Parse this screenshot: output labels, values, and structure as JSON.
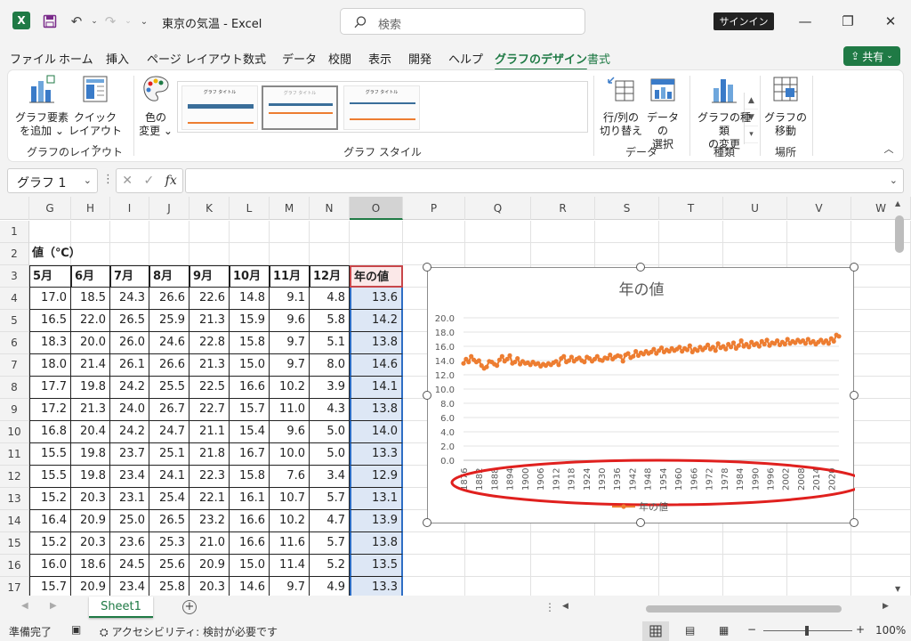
{
  "window": {
    "title": "東京の気温  -  Excel",
    "search_placeholder": "検索",
    "signin_label": "サインイン",
    "minimize": "—",
    "restore": "❐",
    "close": "✕"
  },
  "tabs": [
    "ファイル",
    "ホーム",
    "挿入",
    "ページ レイアウト",
    "数式",
    "データ",
    "校閲",
    "表示",
    "開発",
    "ヘルプ",
    "グラフのデザイン",
    "書式"
  ],
  "active_tab": "グラフのデザイン",
  "share_label": "共有",
  "ribbon": {
    "add_element": [
      "グラフ要素",
      "を追加 ⌄"
    ],
    "quick_layout": [
      "クイック",
      "レイアウト ⌄"
    ],
    "group_layout": "グラフのレイアウト",
    "change_colors": [
      "色の",
      "変更 ⌄"
    ],
    "group_styles": "グラフ スタイル",
    "switch_rowcol": [
      "行/列の",
      "切り替え"
    ],
    "select_data": [
      "データの",
      "選択"
    ],
    "group_data": "データ",
    "change_type": [
      "グラフの種類",
      "の変更"
    ],
    "group_type": "種類",
    "move_chart": [
      "グラフの",
      "移動"
    ],
    "group_location": "場所",
    "thumb_title": "グラフ タイトル",
    "collapse": "︿"
  },
  "formula_bar": {
    "name_box": "グラフ 1",
    "fx": "fx",
    "content": ""
  },
  "columns": [
    "G",
    "H",
    "I",
    "J",
    "K",
    "L",
    "M",
    "N",
    "O",
    "P",
    "Q",
    "R",
    "S",
    "T",
    "U",
    "V",
    "W"
  ],
  "rows": [
    "1",
    "2",
    "3",
    "4",
    "5",
    "6",
    "7",
    "8",
    "9",
    "10",
    "11",
    "12",
    "13",
    "14",
    "15",
    "16",
    "17"
  ],
  "sheet": {
    "label_cell": "値（℃）",
    "headers": [
      "5月",
      "6月",
      "7月",
      "8月",
      "9月",
      "10月",
      "11月",
      "12月",
      "年の値"
    ],
    "data": [
      [
        "17.0",
        "18.5",
        "24.3",
        "26.6",
        "22.6",
        "14.8",
        "9.1",
        "4.8",
        "13.6"
      ],
      [
        "16.5",
        "22.0",
        "26.5",
        "25.9",
        "21.3",
        "15.9",
        "9.6",
        "5.8",
        "14.2"
      ],
      [
        "18.3",
        "20.0",
        "26.0",
        "24.6",
        "22.8",
        "15.8",
        "9.7",
        "5.1",
        "13.8"
      ],
      [
        "18.0",
        "21.4",
        "26.1",
        "26.6",
        "21.3",
        "15.0",
        "9.7",
        "8.0",
        "14.6"
      ],
      [
        "17.7",
        "19.8",
        "24.2",
        "25.5",
        "22.5",
        "16.6",
        "10.2",
        "3.9",
        "14.1"
      ],
      [
        "17.2",
        "21.3",
        "24.0",
        "26.7",
        "22.7",
        "15.7",
        "11.0",
        "4.3",
        "13.8"
      ],
      [
        "16.8",
        "20.4",
        "24.2",
        "24.7",
        "21.1",
        "15.4",
        "9.6",
        "5.0",
        "14.0"
      ],
      [
        "15.5",
        "19.8",
        "23.7",
        "25.1",
        "21.8",
        "16.7",
        "10.0",
        "5.0",
        "13.3"
      ],
      [
        "15.5",
        "19.8",
        "23.4",
        "24.1",
        "22.3",
        "15.8",
        "7.6",
        "3.4",
        "12.9"
      ],
      [
        "15.2",
        "20.3",
        "23.1",
        "25.4",
        "22.1",
        "16.1",
        "10.7",
        "5.7",
        "13.1"
      ],
      [
        "16.4",
        "20.9",
        "25.0",
        "26.5",
        "23.2",
        "16.6",
        "10.2",
        "4.7",
        "13.9"
      ],
      [
        "15.2",
        "20.3",
        "23.6",
        "25.3",
        "21.0",
        "16.6",
        "11.6",
        "5.7",
        "13.8"
      ],
      [
        "16.0",
        "18.6",
        "24.5",
        "25.6",
        "20.9",
        "15.0",
        "11.4",
        "5.2",
        "13.5"
      ],
      [
        "15.7",
        "20.9",
        "23.4",
        "25.8",
        "20.3",
        "14.6",
        "9.7",
        "4.9",
        "13.3"
      ]
    ]
  },
  "chart_data": {
    "type": "line",
    "title": "年の値",
    "legend": "年の値",
    "legend_position": "bottom",
    "ylim": [
      0,
      20
    ],
    "yticks": [
      "20.0",
      "18.0",
      "16.0",
      "14.0",
      "12.0",
      "10.0",
      "8.0",
      "6.0",
      "4.0",
      "2.0",
      "0.0"
    ],
    "x_tick_labels": [
      "1876",
      "1882",
      "1888",
      "1894",
      "1900",
      "1906",
      "1912",
      "1918",
      "1924",
      "1930",
      "1936",
      "1942",
      "1948",
      "1954",
      "1960",
      "1966",
      "1972",
      "1978",
      "1984",
      "1990",
      "1996",
      "2002",
      "2008",
      "2014",
      "2020"
    ],
    "x_range": [
      1876,
      2023
    ],
    "series": [
      {
        "name": "年の値",
        "color": "#ed7d31",
        "values": [
          13.6,
          14.2,
          13.8,
          14.6,
          14.1,
          13.8,
          14.0,
          13.3,
          12.9,
          13.1,
          13.9,
          13.8,
          13.5,
          13.3,
          14.1,
          14.6,
          13.9,
          14.2,
          14.7,
          13.6,
          13.8,
          14.3,
          13.5,
          13.9,
          13.6,
          13.7,
          13.4,
          13.8,
          13.5,
          13.6,
          13.2,
          13.5,
          13.3,
          13.6,
          13.4,
          13.7,
          13.9,
          13.4,
          14.3,
          14.6,
          13.8,
          14.0,
          14.5,
          13.9,
          14.2,
          14.4,
          14.0,
          13.8,
          14.5,
          14.3,
          13.9,
          14.2,
          14.6,
          14.1,
          14.0,
          14.4,
          14.3,
          14.8,
          14.2,
          14.5,
          14.7,
          14.6,
          13.9,
          14.8,
          15.0,
          14.4,
          14.6,
          15.3,
          14.7,
          15.1,
          14.9,
          15.3,
          15.0,
          15.2,
          15.6,
          15.0,
          15.4,
          15.8,
          15.2,
          15.5,
          15.3,
          15.7,
          15.4,
          15.6,
          15.9,
          15.3,
          15.7,
          15.5,
          16.1,
          15.2,
          15.6,
          15.4,
          15.9,
          15.5,
          15.8,
          16.2,
          15.6,
          15.9,
          15.4,
          16.4,
          15.8,
          16.0,
          15.6,
          16.3,
          15.9,
          16.5,
          15.7,
          16.1,
          16.8,
          16.0,
          16.3,
          15.9,
          16.6,
          16.2,
          16.4,
          16.0,
          16.7,
          16.3,
          16.9,
          16.1,
          16.5,
          16.4,
          16.8,
          16.2,
          16.6,
          16.3,
          17.0,
          16.4,
          16.7,
          16.5,
          16.9,
          16.6,
          16.8,
          16.4,
          17.0,
          16.5,
          16.7,
          16.3,
          16.6,
          16.9,
          16.5,
          16.8,
          16.4,
          17.1,
          16.7,
          17.6,
          17.4
        ]
      }
    ]
  },
  "sheet_tab": "Sheet1",
  "status": {
    "ready": "準備完了",
    "accessibility": "アクセシビリティ: 検討が必要です",
    "zoom": "100%"
  },
  "colors": {
    "accent": "#1f7a45",
    "series": "#ed7d31",
    "annotation": "#e0201e"
  }
}
